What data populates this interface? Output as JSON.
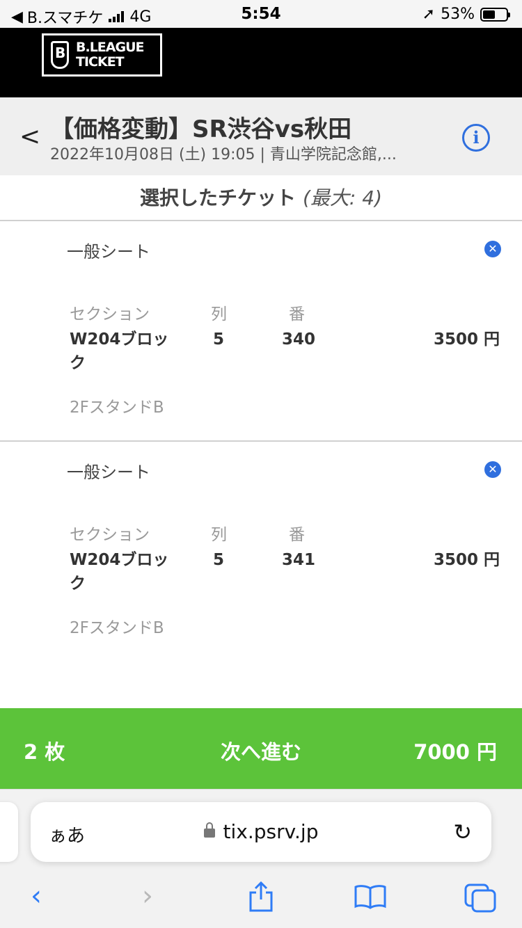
{
  "status_bar": {
    "carrier": "B.スマチケ",
    "network": "4G",
    "time": "5:54",
    "battery": "53%"
  },
  "brand": {
    "logo_line1": "B.LEAGUE",
    "logo_line2": "TICKET"
  },
  "event": {
    "title": "【価格変動】SR渋谷vs秋田",
    "subtitle": "2022年10月08日 (土) 19:05 | 青山学院記念館,..."
  },
  "selection": {
    "heading": "選択したチケット",
    "max": "(最大: 4)"
  },
  "labels": {
    "section": "セクション",
    "row": "列",
    "number": "番"
  },
  "tickets": [
    {
      "seat_type": "一般シート",
      "section": "W204ブロック",
      "row": "5",
      "number": "340",
      "price": "3500 円",
      "area": "2FスタンドB"
    },
    {
      "seat_type": "一般シート",
      "section": "W204ブロック",
      "row": "5",
      "number": "341",
      "price": "3500 円",
      "area": "2FスタンドB"
    }
  ],
  "action_bar": {
    "count": "2 枚",
    "next_label": "次へ進む",
    "total": "7000 円"
  },
  "browser": {
    "aa": "ぁあ",
    "url": "tix.psrv.jp"
  },
  "colors": {
    "accent_blue": "#2f6fde",
    "action_green": "#5cc33a"
  }
}
